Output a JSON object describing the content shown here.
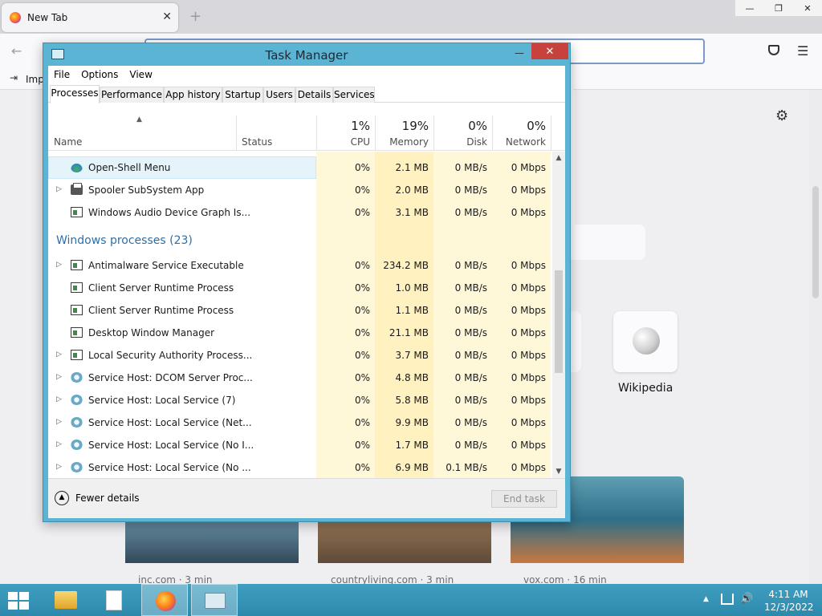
{
  "browser": {
    "tab_title": "New Tab",
    "tab_close": "✕",
    "new_tab": "+",
    "window_controls": {
      "minimize": "—",
      "maximize": "❐",
      "close": "✕"
    },
    "back": "←",
    "menu": "☰",
    "bookmark_label": "Imp",
    "shortcut_label": "Wikipedia",
    "stories": [
      {
        "source": "inc.com · 3 min"
      },
      {
        "source": "countryliving.com · 3 min"
      },
      {
        "source": "vox.com · 16 min"
      }
    ]
  },
  "task_manager": {
    "title": "Task Manager",
    "window_controls": {
      "minimize": "—",
      "maximize": "☐",
      "close": "✕"
    },
    "menu": [
      "File",
      "Options",
      "View"
    ],
    "tabs": [
      "Processes",
      "Performance",
      "App history",
      "Startup",
      "Users",
      "Details",
      "Services"
    ],
    "active_tab": "Processes",
    "columns": {
      "name": "Name",
      "status": "Status",
      "cpu": {
        "pct": "1%",
        "label": "CPU"
      },
      "memory": {
        "pct": "19%",
        "label": "Memory"
      },
      "disk": {
        "pct": "0%",
        "label": "Disk"
      },
      "network": {
        "pct": "0%",
        "label": "Network"
      }
    },
    "apps_rows": [
      {
        "name": "Open-Shell Menu",
        "icon": "shell-icon",
        "expandable": false,
        "selected": true,
        "cpu": "0%",
        "memory": "2.1 MB",
        "disk": "0 MB/s",
        "network": "0 Mbps"
      },
      {
        "name": "Spooler SubSystem App",
        "icon": "printer-icon",
        "expandable": true,
        "cpu": "0%",
        "memory": "2.0 MB",
        "disk": "0 MB/s",
        "network": "0 Mbps"
      },
      {
        "name": "Windows Audio Device Graph Is...",
        "icon": "window-icon",
        "expandable": false,
        "cpu": "0%",
        "memory": "3.1 MB",
        "disk": "0 MB/s",
        "network": "0 Mbps"
      }
    ],
    "group_header": "Windows processes (23)",
    "windows_rows": [
      {
        "name": "Antimalware Service Executable",
        "icon": "window-icon",
        "expandable": true,
        "cpu": "0%",
        "memory": "234.2 MB",
        "disk": "0 MB/s",
        "network": "0 Mbps"
      },
      {
        "name": "Client Server Runtime Process",
        "icon": "window-icon",
        "expandable": false,
        "cpu": "0%",
        "memory": "1.0 MB",
        "disk": "0 MB/s",
        "network": "0 Mbps"
      },
      {
        "name": "Client Server Runtime Process",
        "icon": "window-icon",
        "expandable": false,
        "cpu": "0%",
        "memory": "1.1 MB",
        "disk": "0 MB/s",
        "network": "0 Mbps"
      },
      {
        "name": "Desktop Window Manager",
        "icon": "window-icon",
        "expandable": false,
        "cpu": "0%",
        "memory": "21.1 MB",
        "disk": "0 MB/s",
        "network": "0 Mbps"
      },
      {
        "name": "Local Security Authority Process...",
        "icon": "window-icon",
        "expandable": true,
        "cpu": "0%",
        "memory": "3.7 MB",
        "disk": "0 MB/s",
        "network": "0 Mbps"
      },
      {
        "name": "Service Host: DCOM Server Proc...",
        "icon": "gear-icon",
        "expandable": true,
        "cpu": "0%",
        "memory": "4.8 MB",
        "disk": "0 MB/s",
        "network": "0 Mbps"
      },
      {
        "name": "Service Host: Local Service (7)",
        "icon": "gear-icon",
        "expandable": true,
        "cpu": "0%",
        "memory": "5.8 MB",
        "disk": "0 MB/s",
        "network": "0 Mbps"
      },
      {
        "name": "Service Host: Local Service (Net...",
        "icon": "gear-icon",
        "expandable": true,
        "cpu": "0%",
        "memory": "9.9 MB",
        "disk": "0 MB/s",
        "network": "0 Mbps"
      },
      {
        "name": "Service Host: Local Service (No I...",
        "icon": "gear-icon",
        "expandable": true,
        "cpu": "0%",
        "memory": "1.7 MB",
        "disk": "0 MB/s",
        "network": "0 Mbps"
      },
      {
        "name": "Service Host: Local Service (No ...",
        "icon": "gear-icon",
        "expandable": true,
        "cpu": "0%",
        "memory": "6.9 MB",
        "disk": "0.1 MB/s",
        "network": "0 Mbps"
      }
    ],
    "fewer_details": "Fewer details",
    "end_task": "End task"
  },
  "taskbar": {
    "time": "4:11 AM",
    "date": "12/3/2022",
    "apps": [
      "file-explorer-icon",
      "document-icon",
      "firefox-icon",
      "task-manager-icon"
    ],
    "active_app": "firefox-icon"
  },
  "colors": {
    "heat_light": "#fff8d8",
    "heat_mid": "#fff1c0",
    "group_header": "#2d6fa8",
    "taskbar": "#3492b5",
    "close_button": "#c7423c"
  }
}
